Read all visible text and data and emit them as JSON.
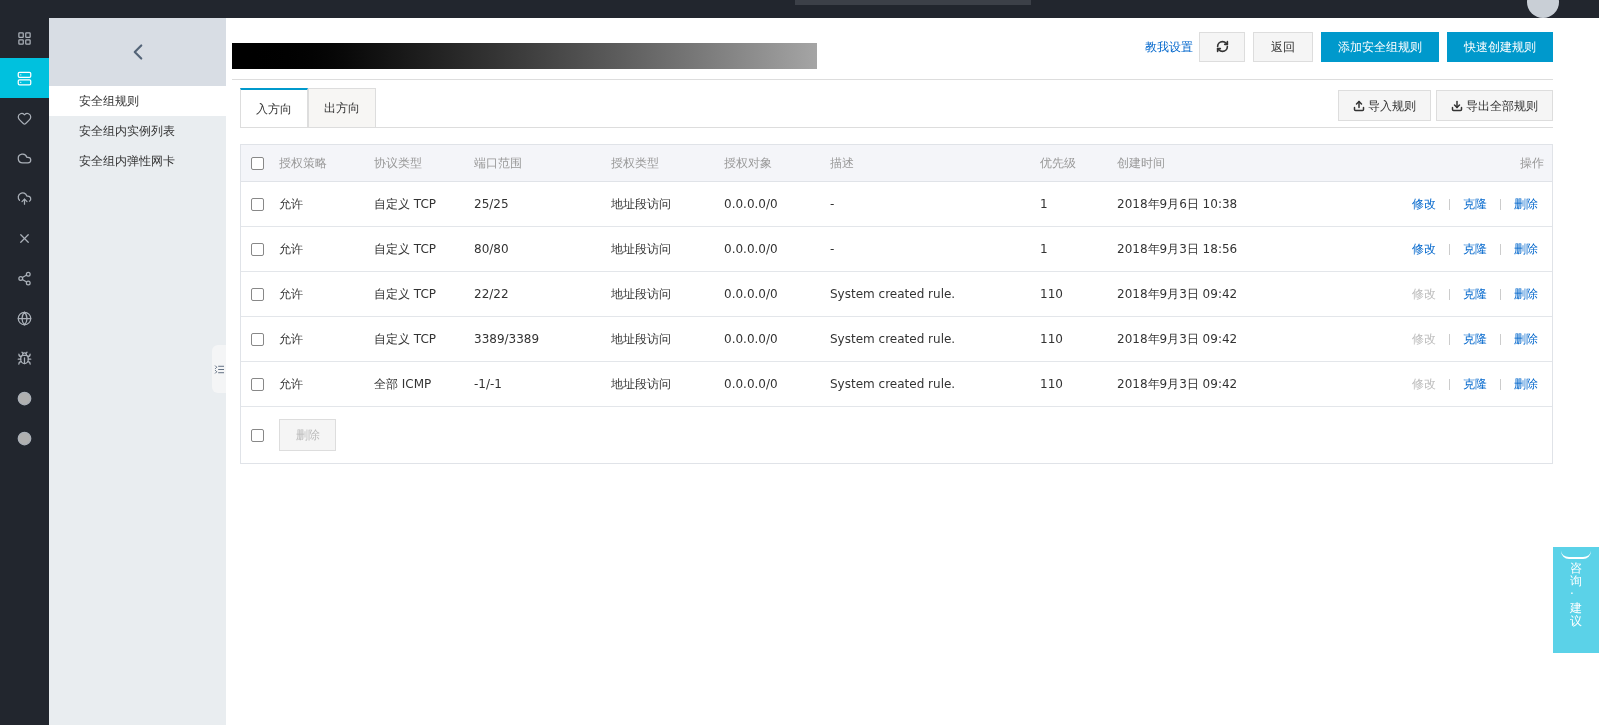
{
  "rail_items": [
    {
      "selected": false
    },
    {
      "selected": true
    },
    {
      "selected": false
    },
    {
      "selected": false
    },
    {
      "selected": false
    },
    {
      "selected": false
    },
    {
      "selected": false
    },
    {
      "selected": false
    },
    {
      "selected": false
    },
    {
      "selected": false
    },
    {
      "selected": false
    }
  ],
  "sidebar": {
    "items": [
      {
        "label": "安全组规则",
        "selected": true
      },
      {
        "label": "安全组内实例列表",
        "selected": false
      },
      {
        "label": "安全组内弹性网卡",
        "selected": false
      }
    ]
  },
  "header": {
    "help_link": "教我设置",
    "buttons": [
      {
        "label": "返回",
        "kind": "default"
      },
      {
        "label": "添加安全组规则",
        "kind": "primary"
      },
      {
        "label": "快速创建规则",
        "kind": "primary"
      }
    ]
  },
  "tabs": [
    {
      "label": "入方向",
      "selected": true
    },
    {
      "label": "出方向",
      "selected": false
    }
  ],
  "tools": [
    {
      "label": "导入规则",
      "kind": "upload"
    },
    {
      "label": "导出全部规则",
      "kind": "download"
    }
  ],
  "table": {
    "select_all": false,
    "columns": [
      "授权策略",
      "协议类型",
      "端口范围",
      "授权类型",
      "授权对象",
      "描述",
      "优先级",
      "创建时间",
      "操作"
    ],
    "rows": [
      {
        "checked": false,
        "cells": [
          "允许",
          "自定义 TCP",
          "25/25",
          "地址段访问",
          "0.0.0.0/0",
          "-",
          "1",
          "2018年9月6日 10:38"
        ],
        "actions": [
          {
            "label": "修改",
            "disabled": false
          },
          {
            "label": "克隆",
            "disabled": false
          },
          {
            "label": "删除",
            "disabled": false
          }
        ]
      },
      {
        "checked": false,
        "cells": [
          "允许",
          "自定义 TCP",
          "80/80",
          "地址段访问",
          "0.0.0.0/0",
          "-",
          "1",
          "2018年9月3日 18:56"
        ],
        "actions": [
          {
            "label": "修改",
            "disabled": false
          },
          {
            "label": "克隆",
            "disabled": false
          },
          {
            "label": "删除",
            "disabled": false
          }
        ]
      },
      {
        "checked": false,
        "cells": [
          "允许",
          "自定义 TCP",
          "22/22",
          "地址段访问",
          "0.0.0.0/0",
          "System created rule.",
          "110",
          "2018年9月3日 09:42"
        ],
        "actions": [
          {
            "label": "修改",
            "disabled": true
          },
          {
            "label": "克隆",
            "disabled": false
          },
          {
            "label": "删除",
            "disabled": false
          }
        ]
      },
      {
        "checked": false,
        "cells": [
          "允许",
          "自定义 TCP",
          "3389/3389",
          "地址段访问",
          "0.0.0.0/0",
          "System created rule.",
          "110",
          "2018年9月3日 09:42"
        ],
        "actions": [
          {
            "label": "修改",
            "disabled": true
          },
          {
            "label": "克隆",
            "disabled": false
          },
          {
            "label": "删除",
            "disabled": false
          }
        ]
      },
      {
        "checked": false,
        "cells": [
          "允许",
          "全部 ICMP",
          "-1/-1",
          "地址段访问",
          "0.0.0.0/0",
          "System created rule.",
          "110",
          "2018年9月3日 09:42"
        ],
        "actions": [
          {
            "label": "修改",
            "disabled": true
          },
          {
            "label": "克隆",
            "disabled": false
          },
          {
            "label": "删除",
            "disabled": false
          }
        ]
      }
    ],
    "footer": {
      "checked": false,
      "button": {
        "label": "删除",
        "disabled": true
      }
    }
  },
  "float_tab": "咨询·建议"
}
